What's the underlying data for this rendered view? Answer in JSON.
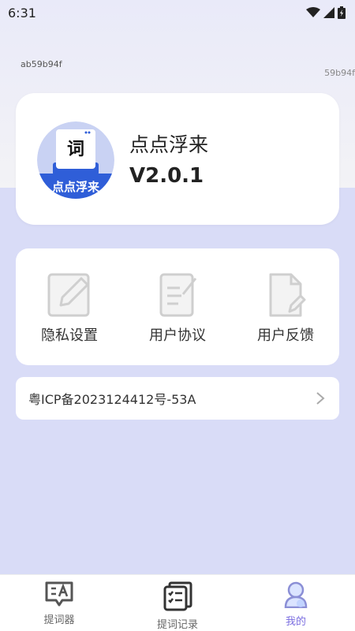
{
  "status_bar": {
    "time": "6:31"
  },
  "debug": {
    "left_id": "ab59b94f",
    "right_id": "59b94f"
  },
  "app": {
    "name": "点点浮来",
    "version": "V2.0.1",
    "logo_char": "词",
    "logo_text": "点点浮来"
  },
  "menu": {
    "items": [
      {
        "label": "隐私设置",
        "icon": "edit-icon"
      },
      {
        "label": "用户协议",
        "icon": "agreement-icon"
      },
      {
        "label": "用户反馈",
        "icon": "feedback-icon"
      }
    ]
  },
  "icp": {
    "text": "粤ICP备2023124412号-53A"
  },
  "tab_bar": {
    "tabs": [
      {
        "label": "提词器",
        "icon": "teleprompter-icon"
      },
      {
        "label": "提词记录",
        "icon": "records-icon"
      },
      {
        "label": "我的",
        "icon": "profile-icon",
        "active": true
      }
    ]
  },
  "colors": {
    "accent": "#7b6ee0",
    "logo_blue": "#2f5ed8",
    "background": "#d9dcf7"
  }
}
